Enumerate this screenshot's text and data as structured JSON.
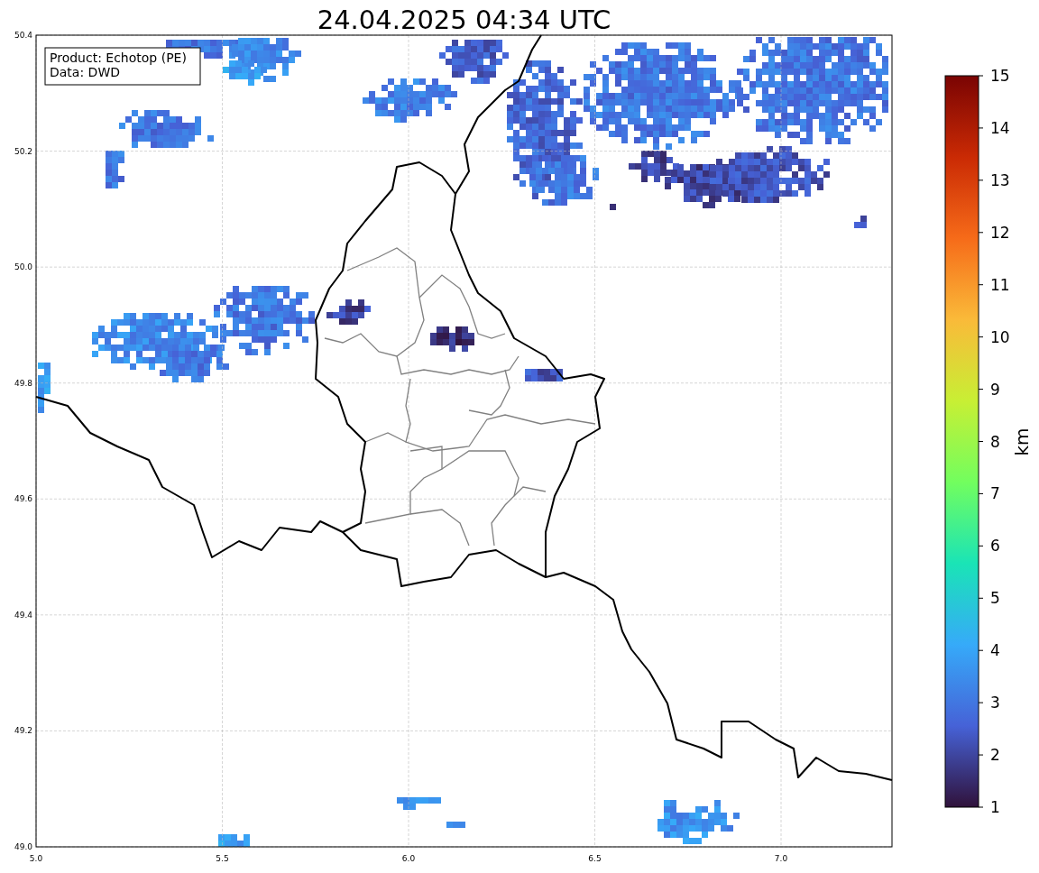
{
  "title": "24.04.2025 04:34 UTC",
  "legend": [
    "Product: Echotop (PE)",
    "Data: DWD"
  ],
  "map": {
    "xticks": [
      "5.0",
      "5.5",
      "6.0",
      "6.5",
      "7.0"
    ],
    "yticks": [
      "50.4",
      "50.2",
      "50.0",
      "49.8",
      "49.6",
      "49.4",
      "49.2",
      "49.0"
    ]
  },
  "colorbar": {
    "label": "km",
    "ticks": [
      "15",
      "14",
      "13",
      "12",
      "11",
      "10",
      "9",
      "8",
      "7",
      "6",
      "5",
      "4",
      "3",
      "2",
      "1"
    ]
  }
}
